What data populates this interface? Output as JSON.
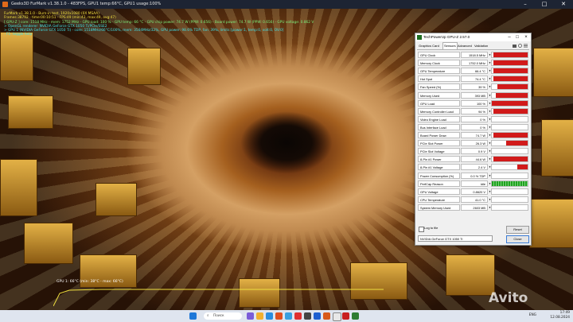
{
  "window": {
    "title": "Geeks3D FurMark v1.38.1.0 - 483FPS, GPU1 temp:66°C, GPU1 usage:100%"
  },
  "overlay": {
    "line1": "FurMark v1.38.1.0 - Burn-in test, 1920x1080 (0X MSAA)",
    "line2": "Frames:38792 - time:00:10:51 - FPS:49 (min:43, max:49, avg:47)",
    "line3": "[ GPU-Z ] core: 1518 MHz - mem: 1752 MHz - GPU load: 100 % - GPU temp: 66 °C - GPU chip power: 74.7 W (PPW: 0.656) - Board power: 74.7 W (PPW: 0.656) - GPU voltage: 0.862 V",
    "line4": "> OpenGL renderer: NVIDIA GeForce GTX 1050 Ti/PCIe/SSE2",
    "line5": "> GPU 1 (NVIDIA GeForce GTX 1050 Ti) - core: 1518MHz/66°C/100%, mem: 3504MHz/32%, GPU power: 98.6% TDP, fan: 39%, limits:[power:1, temp:0, volt:0, OV:0]",
    "line6": "- F1: toggle help"
  },
  "temp_graph": {
    "label": "GPU 1: 66°C (min: 38°C - max: 66°C)"
  },
  "gpuz": {
    "title": "TechPowerUp GPU-Z 2.57.0",
    "tabs": [
      "Graphics Card",
      "Sensors",
      "Advanced",
      "Validation"
    ],
    "active_tab": "Sensors",
    "sensors": [
      {
        "label": "GPU Clock",
        "value": "1518.5 MHz",
        "level": 0.95
      },
      {
        "label": "Memory Clock",
        "value": "1752.0 MHz",
        "level": 0.95
      },
      {
        "label": "GPU Temperature",
        "value": "66.4 °C",
        "level": 0.95
      },
      {
        "label": "Hot Spot",
        "value": "74.4 °C",
        "level": 0.95
      },
      {
        "label": "Fan Speed (%)",
        "value": "39 %",
        "level": 0.85
      },
      {
        "label": "Memory Used",
        "value": "393 MB",
        "level": 0.9
      },
      {
        "label": "GPU Load",
        "value": "100 %",
        "level": 1.0
      },
      {
        "label": "Memory Controller Load",
        "value": "94 %",
        "level": 0.95
      },
      {
        "label": "Video Engine Load",
        "value": "0 %",
        "level": 0
      },
      {
        "label": "Bus Interface Load",
        "value": "0 %",
        "level": 0
      },
      {
        "label": "Board Power Draw",
        "value": "74.7 W",
        "level": 0.95
      },
      {
        "label": "PCIe Slot Power",
        "value": "26.3 W",
        "level": 0.6
      },
      {
        "label": "PCIe Slot Voltage",
        "value": "0.9 V",
        "level": 0
      },
      {
        "label": "8-Pin #1 Power",
        "value": "44.6 W",
        "level": 0.95
      },
      {
        "label": "8-Pin #1 Voltage",
        "value": "2.4 V",
        "level": 0.3
      },
      {
        "label": "Power Consumption (%)",
        "value": "0.0 % TDP",
        "level": 0
      },
      {
        "label": "PerfCap Reason",
        "value": "Idle",
        "level": 1.0,
        "green": true
      },
      {
        "label": "GPU Voltage",
        "value": "0.8620 V",
        "level": 0
      },
      {
        "label": "CPU Temperature",
        "value": "41.0 °C",
        "level": 0
      },
      {
        "label": "System Memory Used",
        "value": "2603 MB",
        "level": 0
      }
    ],
    "log_label": "Log to file",
    "reset_label": "Reset",
    "gpu_select": "NVIDIA GeForce GTX 1050 Ti",
    "close_label": "Close"
  },
  "taskbar": {
    "search_placeholder": "Поиск",
    "lang": "ENG",
    "time": "17:49",
    "date": "12.08.2024"
  },
  "watermark": "Avito",
  "colors": {
    "sensor_bar": "#d11a1a",
    "perfcap_bar": "#1fa21f",
    "overlay_cyan": "#3fe0e8"
  }
}
